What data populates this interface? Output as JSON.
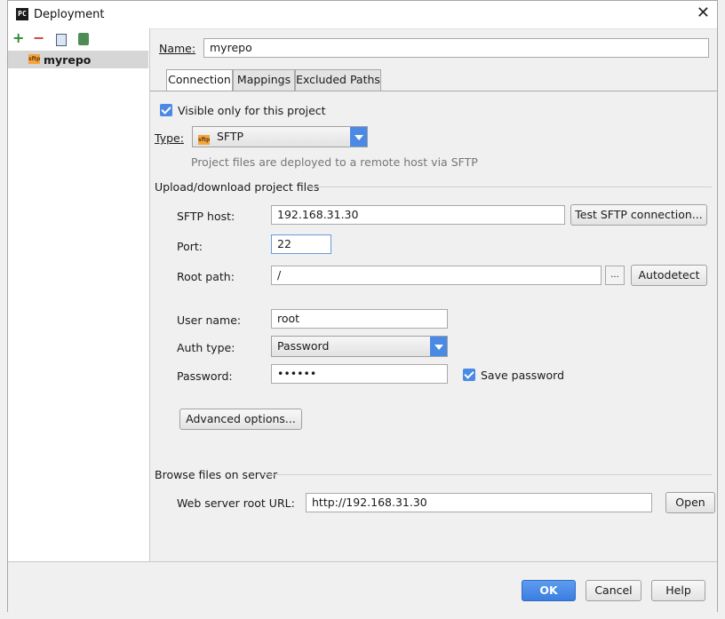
{
  "window": {
    "title": "Deployment",
    "app_icon": "PC"
  },
  "sidebar": {
    "toolbar": [
      "add-icon",
      "remove-icon",
      "copy-icon",
      "set-default-icon"
    ],
    "items": [
      {
        "badge": "sftp",
        "label": "myrepo"
      }
    ]
  },
  "name_field": {
    "label": "Name:",
    "value": "myrepo"
  },
  "tabs": [
    {
      "label": "Connection",
      "active": true
    },
    {
      "label": "Mappings",
      "active": false
    },
    {
      "label": "Excluded Paths",
      "active": false
    }
  ],
  "visible_only": {
    "label": "Visible only for this project",
    "checked": true
  },
  "type": {
    "label": "Type:",
    "badge": "sftp",
    "value": "SFTP",
    "hint": "Project files are deployed to a remote host via SFTP"
  },
  "upload_section": {
    "title": "Upload/download project files",
    "host_label": "SFTP host:",
    "host_value": "192.168.31.30",
    "test_button": "Test SFTP connection...",
    "port_label": "Port:",
    "port_value": "22",
    "root_label": "Root path:",
    "root_value": "/",
    "browse_button": "...",
    "autodetect_button": "Autodetect",
    "user_label": "User name:",
    "user_value": "root",
    "auth_label": "Auth type:",
    "auth_value": "Password",
    "password_label": "Password:",
    "password_value": "••••••",
    "save_password_label": "Save password",
    "save_password_checked": true,
    "advanced_button": "Advanced options..."
  },
  "browse_section": {
    "title": "Browse files on server",
    "url_label": "Web server root URL:",
    "url_value": "http://192.168.31.30",
    "open_button": "Open"
  },
  "footer": {
    "ok": "OK",
    "cancel": "Cancel",
    "help": "Help"
  },
  "colors": {
    "accent": "#4a8ae5",
    "primary_button": "#3a7ee0"
  }
}
